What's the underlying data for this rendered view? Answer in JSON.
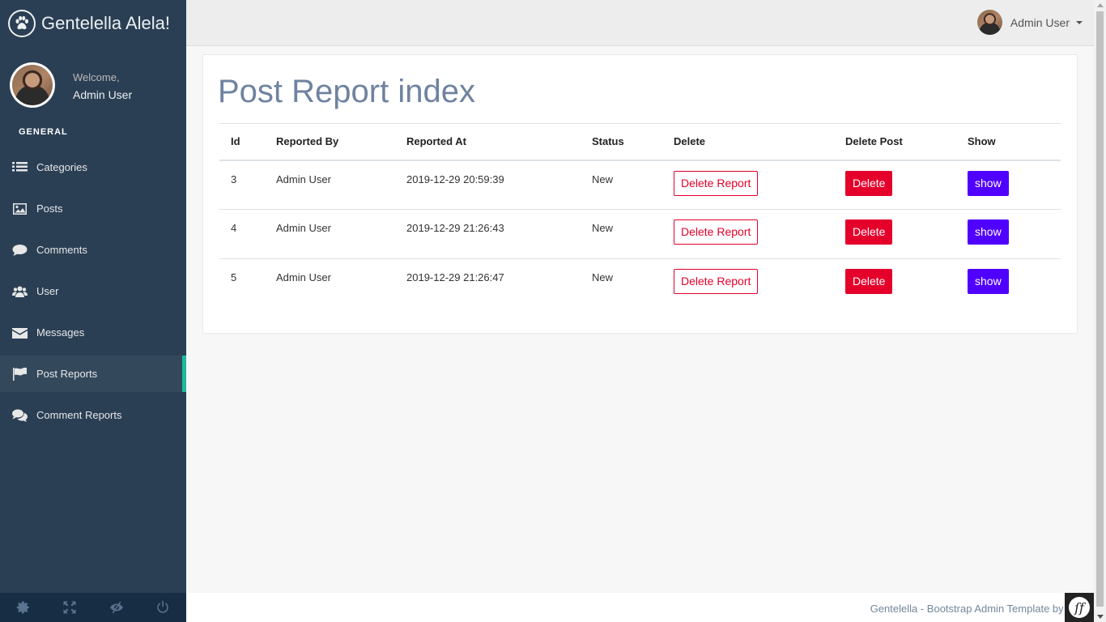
{
  "brand": {
    "title": "Gentelella Alela!",
    "icon": "paw-icon"
  },
  "profile": {
    "welcome": "Welcome,",
    "name": "Admin User"
  },
  "sidebar": {
    "section_title": "GENERAL",
    "items": [
      {
        "label": "Categories",
        "icon": "list-icon"
      },
      {
        "label": "Posts",
        "icon": "image-icon"
      },
      {
        "label": "Comments",
        "icon": "comment-icon"
      },
      {
        "label": "User",
        "icon": "users-icon"
      },
      {
        "label": "Messages",
        "icon": "envelope-icon"
      },
      {
        "label": "Post Reports",
        "icon": "flag-icon",
        "active": true
      },
      {
        "label": "Comment Reports",
        "icon": "comments-icon"
      }
    ],
    "footer_icons": [
      "settings-icon",
      "fullscreen-icon",
      "eye-slash-icon",
      "power-icon"
    ]
  },
  "topnav": {
    "user_name": "Admin User"
  },
  "page": {
    "title": "Post Report index",
    "table": {
      "headers": [
        "Id",
        "Reported By",
        "Reported At",
        "Status",
        "Delete",
        "Delete Post",
        "Show"
      ],
      "rows": [
        {
          "id": "3",
          "reported_by": "Admin User",
          "reported_at": "2019-12-29 20:59:39",
          "status": "New",
          "delete_label": "Delete Report",
          "delete_post_label": "Delete",
          "show_label": "show"
        },
        {
          "id": "4",
          "reported_by": "Admin User",
          "reported_at": "2019-12-29 21:26:43",
          "status": "New",
          "delete_label": "Delete Report",
          "delete_post_label": "Delete",
          "show_label": "show"
        },
        {
          "id": "5",
          "reported_by": "Admin User",
          "reported_at": "2019-12-29 21:26:47",
          "status": "New",
          "delete_label": "Delete Report",
          "delete_post_label": "Delete",
          "show_label": "show"
        }
      ]
    }
  },
  "footer": {
    "text": "Gentelella - Bootstrap Admin Template by Colo"
  },
  "colors": {
    "sidebar_bg": "#2A3F54",
    "accent": "#1ABB9C",
    "danger": "#E4002B",
    "primary": "#5000FF"
  }
}
